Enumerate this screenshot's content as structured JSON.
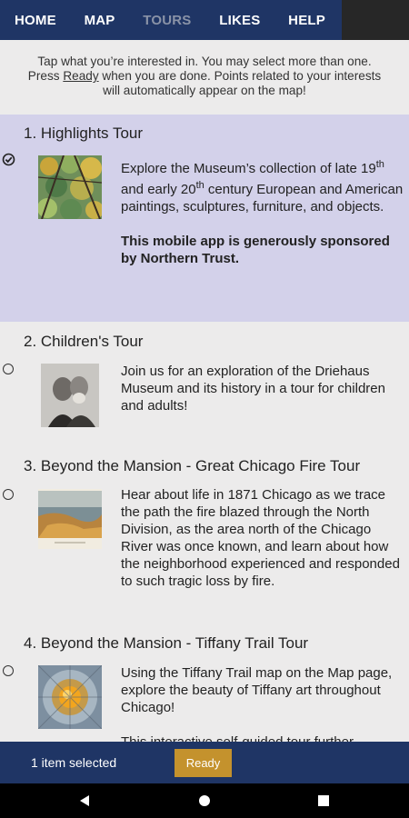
{
  "nav": {
    "items": [
      {
        "label": "HOME"
      },
      {
        "label": "MAP"
      },
      {
        "label": "TOURS",
        "active": true
      },
      {
        "label": "LIKES"
      },
      {
        "label": "HELP"
      }
    ]
  },
  "intro": {
    "line1": "Tap what you’re interested in. You may select more than one.",
    "line2_pre": "Press ",
    "line2_link": "Ready",
    "line2_post": " when you are done. Points related to your interests",
    "line3": "will automatically appear on the map!"
  },
  "tours": [
    {
      "title": "1. Highlights Tour",
      "selected": true,
      "desc_a": "Explore the Museum’s collection of late 19",
      "sup1": "th",
      "desc_b": "and early 20",
      "sup2": "th",
      "desc_c": " century European and American paintings, sculptures, furniture, and objects.",
      "sponsor": "This mobile app is generously sponsored by Northern Trust."
    },
    {
      "title": "2. Children's Tour",
      "selected": false,
      "desc": "Join us for an exploration of the Driehaus Museum and its history in a tour for children and adults!"
    },
    {
      "title": "3. Beyond the Mansion - Great Chicago Fire Tour",
      "selected": false,
      "desc": "Hear about life in 1871 Chicago as we trace the path the fire blazed through the North Division, as the area north of the Chicago River was once known, and learn about how the neighborhood experienced and responded to such tragic loss by fire."
    },
    {
      "title": "4. Beyond the Mansion - Tiffany Trail Tour",
      "selected": false,
      "desc": "Using the Tiffany Trail map on the Map page, explore the beauty of Tiffany art throughout Chicago!",
      "desc2": "This interactive self-guided tour further"
    }
  ],
  "bottom": {
    "count_label": "1 item selected",
    "ready_label": "Ready"
  },
  "colors": {
    "nav_bg": "#1f3565",
    "selected_bg": "#d3d1ea",
    "ready_bg": "#c4922d",
    "page_bg": "#ecebeb"
  },
  "icons": {
    "check": "checked-radio-icon",
    "back": "back-icon",
    "home": "home-icon",
    "recents": "recents-icon"
  }
}
